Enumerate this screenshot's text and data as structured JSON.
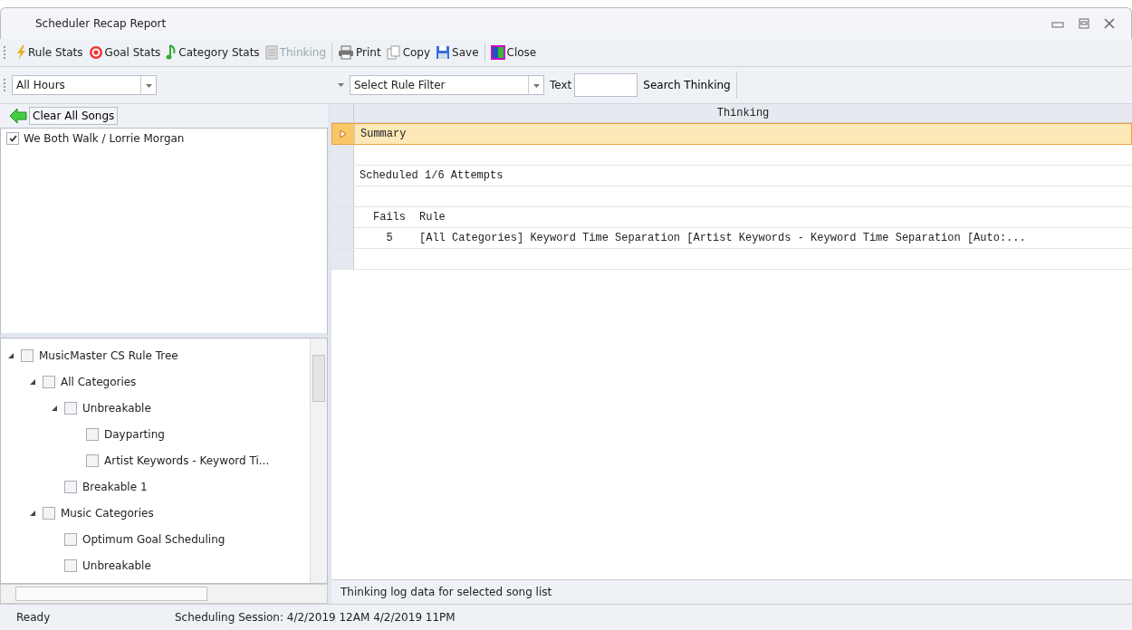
{
  "window": {
    "title": "Scheduler Recap Report"
  },
  "toolbar": [
    {
      "kind": "bolt",
      "label": "Rule Stats",
      "disabled": false
    },
    {
      "kind": "target",
      "label": "Goal Stats",
      "disabled": false
    },
    {
      "kind": "note",
      "label": "Category Stats",
      "disabled": false
    },
    {
      "kind": "doc",
      "label": "Thinking",
      "disabled": true
    },
    {
      "kind": "printer",
      "label": "Print",
      "disabled": false
    },
    {
      "kind": "copy",
      "label": "Copy",
      "disabled": false
    },
    {
      "kind": "disk",
      "label": "Save",
      "disabled": false
    },
    {
      "kind": "door",
      "label": "Close",
      "disabled": false
    }
  ],
  "filters": {
    "hours": "All Hours",
    "rule_filter": "Select Rule Filter",
    "text_label": "Text",
    "search_button": "Search Thinking"
  },
  "songs": {
    "clear_button": "Clear All Songs",
    "items": [
      {
        "label": "We Both Walk / Lorrie Morgan",
        "checked": true
      }
    ]
  },
  "rule_tree": [
    {
      "label": "MusicMaster CS Rule Tree",
      "checked": false,
      "expanded": true,
      "children": [
        {
          "label": "All Categories",
          "checked": false,
          "expanded": true,
          "children": [
            {
              "label": "Unbreakable",
              "checked": false,
              "expanded": true,
              "children": [
                {
                  "label": "Dayparting",
                  "checked": false
                },
                {
                  "label": "Artist Keywords - Keyword Ti...",
                  "checked": false
                }
              ]
            },
            {
              "label": "Breakable 1",
              "checked": false
            }
          ]
        },
        {
          "label": "Music Categories",
          "checked": false,
          "expanded": true,
          "children": [
            {
              "label": "Optimum Goal Scheduling",
              "checked": false
            },
            {
              "label": "Unbreakable",
              "checked": false
            }
          ]
        }
      ]
    }
  ],
  "grid": {
    "column": "Thinking",
    "rows": [
      {
        "selected": true,
        "text": "Summary"
      },
      {
        "selected": false
      },
      {
        "selected": false,
        "text": "Scheduled 1/6 Attempts"
      },
      {
        "selected": false
      },
      {
        "selected": false,
        "col_1": "Fails",
        "col_2": "Rule"
      },
      {
        "selected": false,
        "col_1": "5",
        "col_2": "[All Categories] Keyword Time Separation [Artist Keywords - Keyword Time Separation [Auto:..."
      },
      {
        "selected": false
      }
    ]
  },
  "grid_status": "Thinking log data for selected song list",
  "status_bar": {
    "state": "Ready",
    "session": "Scheduling Session: 4/2/2019 12AM  4/2/2019 11PM"
  }
}
